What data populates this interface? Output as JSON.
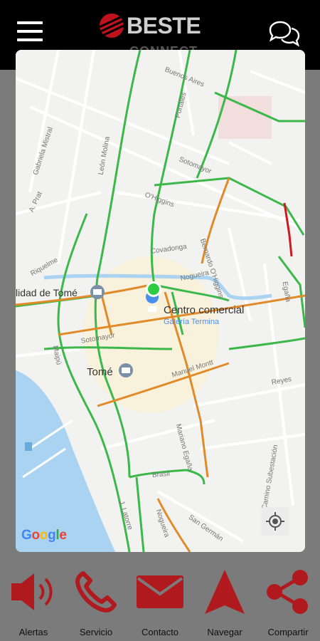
{
  "header": {
    "logo_text": "BESTE",
    "logo_sub": "CONNECT",
    "menu_icon": "hamburger-icon",
    "chat_icon": "chat-bubbles-icon"
  },
  "map": {
    "pois": {
      "municipality": "lidad de Tomé",
      "city": "Tomé",
      "mall_title": "Centro comercial",
      "mall_sub": "Galería Termina"
    },
    "streets": {
      "buenos_aires": "Buenos Aires",
      "portales": "Portales",
      "gabriela": "Gabriela Mistral",
      "leon": "León Molina",
      "sotomayor_n": "Sotomayor",
      "ohiggins": "O'Higgins",
      "a_prat": "A. Prat",
      "covadonga": "Covadonga",
      "bernardo": "Bernardo O'Higgins",
      "riquelme": "Riquelme",
      "nogueira": "Nogueira",
      "egana_r": "Egaña",
      "sotomayor": "Sotomayor",
      "maipu": "Maipú",
      "manuel_montt": "Manuel Montt",
      "reyes": "Reyes",
      "mariano": "Mariano Egaña",
      "brasil": "Brasil",
      "lalatorre": "J. Latorre",
      "nogueira2": "Nogueira",
      "san_german": "San Germán",
      "camino": "Camino Subestación"
    },
    "attribution": "Google"
  },
  "footer": {
    "buttons": [
      {
        "label": "Alertas",
        "icon": "speaker-icon"
      },
      {
        "label": "Servicio",
        "icon": "phone-icon"
      },
      {
        "label": "Contacto",
        "icon": "mail-icon"
      },
      {
        "label": "Navegar",
        "icon": "navigate-arrow-icon"
      },
      {
        "label": "Compartir",
        "icon": "share-icon"
      }
    ]
  },
  "colors": {
    "brand_red": "#b01a1f",
    "traffic_green": "#3cb84a",
    "traffic_orange": "#e08a2a",
    "traffic_red": "#cc1a22",
    "water": "#aad3f2"
  }
}
